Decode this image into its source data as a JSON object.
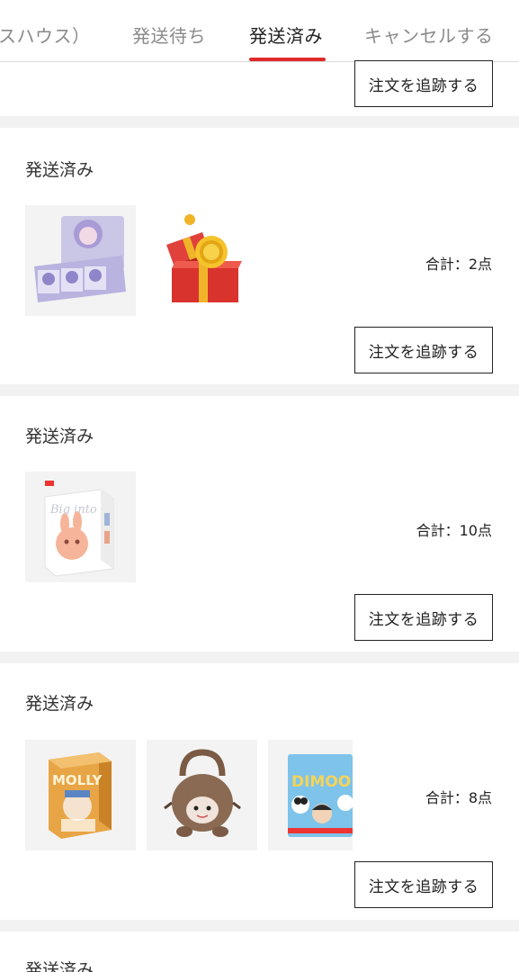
{
  "tabs": [
    {
      "label": "スハウス）",
      "active": false
    },
    {
      "label": "発送待ち",
      "active": false
    },
    {
      "label": "発送済み",
      "active": true
    },
    {
      "label": "キャンセルする",
      "active": false
    }
  ],
  "colors": {
    "accent": "#e02a2a",
    "tab_inactive": "#8a8a8a"
  },
  "top_card": {
    "track_label": "注文を追跡する"
  },
  "orders": [
    {
      "status": "発送済み",
      "total": "合計：2点",
      "track_label": "注文を追跡する",
      "items": [
        "blind-box-display",
        "gift-box-with-coin"
      ]
    },
    {
      "status": "発送済み",
      "total": "合計：10点",
      "track_label": "注文を追跡する",
      "items": [
        "figure-box"
      ]
    },
    {
      "status": "発送済み",
      "total": "合計：8点",
      "track_label": "注文を追跡する",
      "items": [
        "molly-box",
        "plush-bag",
        "dimoo-pack"
      ]
    },
    {
      "status": "発送済み"
    }
  ]
}
